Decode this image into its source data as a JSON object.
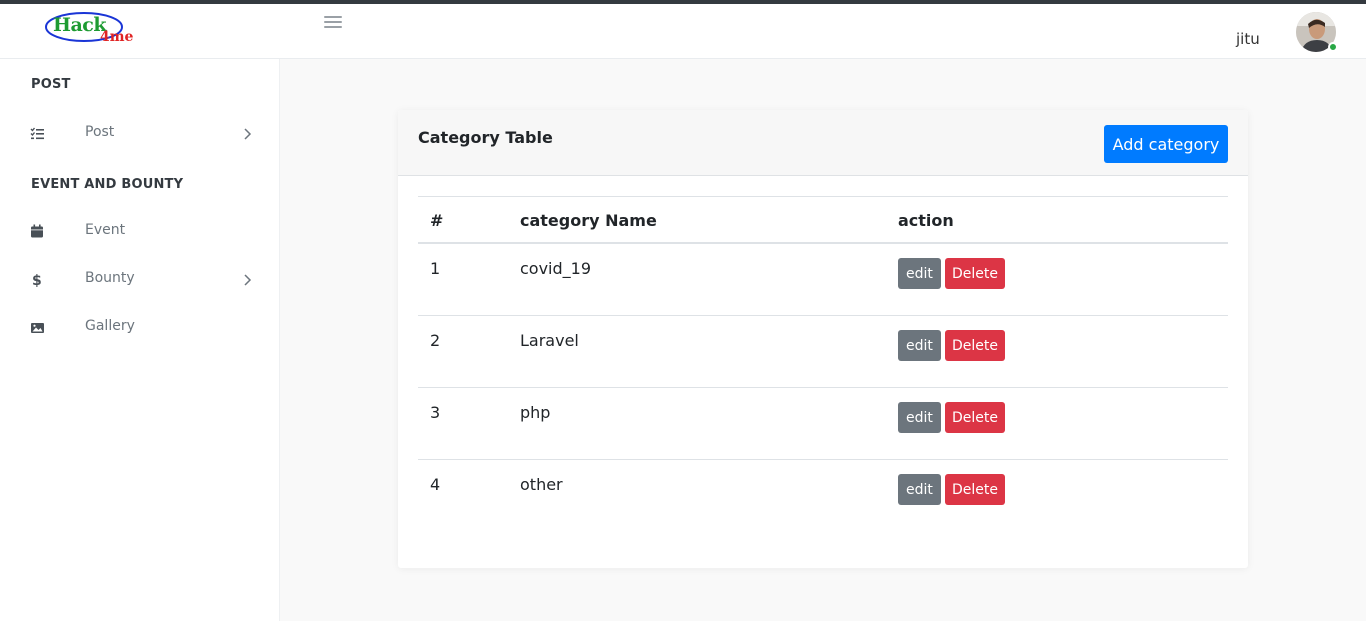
{
  "header": {
    "logo_main": "Hack",
    "logo_sub": "4me",
    "username": "jitu"
  },
  "sidebar": {
    "section1": "POST",
    "section2": "EVENT AND BOUNTY",
    "items": [
      {
        "label": "Post",
        "icon": "list-check-icon"
      },
      {
        "label": "Event",
        "icon": "calendar-icon"
      },
      {
        "label": "Bounty",
        "icon": "dollar-icon"
      },
      {
        "label": "Gallery",
        "icon": "image-icon"
      }
    ]
  },
  "card": {
    "title": "Category Table",
    "add_button": "Add category"
  },
  "table": {
    "headers": [
      "#",
      "category Name",
      "action"
    ],
    "rows": [
      {
        "num": "1",
        "name": "covid_19"
      },
      {
        "num": "2",
        "name": "Laravel"
      },
      {
        "num": "3",
        "name": "php"
      },
      {
        "num": "4",
        "name": "other"
      }
    ],
    "edit_label": "edit",
    "delete_label": "Delete"
  },
  "colors": {
    "primary": "#007bff",
    "secondary": "#6c757d",
    "danger": "#dc3545",
    "status_online": "#28a745"
  }
}
